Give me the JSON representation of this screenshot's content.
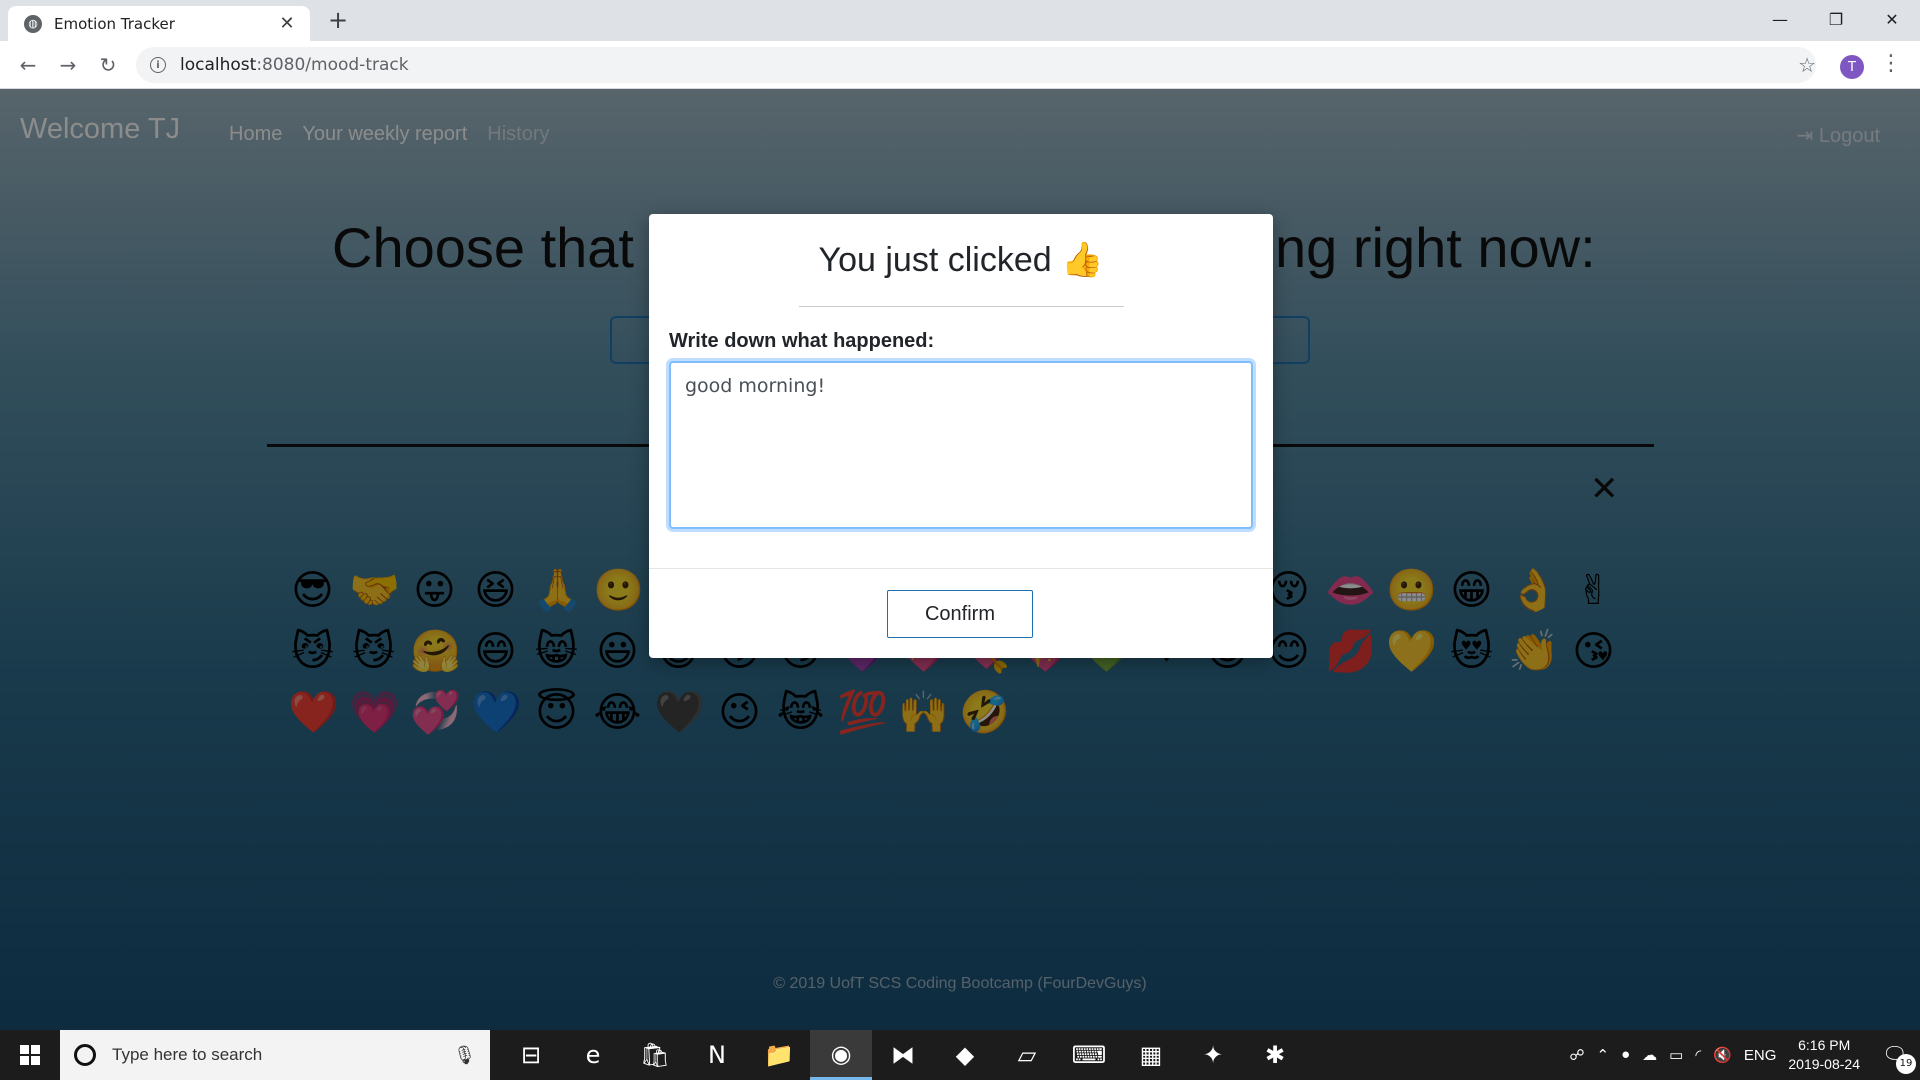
{
  "browser": {
    "tab_title": "Emotion Tracker",
    "tab_close": "✕",
    "new_tab": "+",
    "url_host": "localhost",
    "url_path": ":8080/mood-track",
    "profile_initial": "T",
    "window_controls": {
      "minimize": "—",
      "maximize": "❐",
      "close": "✕"
    },
    "nav": {
      "back": "←",
      "forward": "→",
      "reload": "↻"
    }
  },
  "navbar": {
    "brand": "Welcome TJ",
    "links": [
      "Home",
      "Your weekly report",
      "History"
    ],
    "logout": "Logout",
    "logout_icon": "⇥"
  },
  "main": {
    "headline_left": "Choose that",
    "headline_right": "ng right now:",
    "close_symbol": "✕",
    "emojis": [
      "😎",
      "🤝",
      "😛",
      "😆",
      "🙏",
      "🙂",
      "😚",
      "😊",
      "👍",
      "💋",
      "😅",
      "☺",
      "😌",
      "🤠",
      "😮",
      "🤞",
      "😚",
      "👄",
      "😬",
      "😁",
      "👌",
      "✌",
      "😼",
      "😼",
      "🤗",
      "😄",
      "😸",
      "😃",
      "😺",
      "😗",
      "😏",
      "💜",
      "💝",
      "💘",
      "💖",
      "💚",
      "❤",
      "😍",
      "😊",
      "💋",
      "💛",
      "😻",
      "👏",
      "😘",
      "❤️",
      "💗",
      "💞",
      "💙",
      "😇",
      "😂",
      "🖤",
      "😉",
      "😹",
      "💯",
      "🙌",
      "🤣"
    ],
    "footer": "© 2019 UofT SCS Coding Bootcamp (FourDevGuys)"
  },
  "modal": {
    "title": "You just clicked 👍",
    "label": "Write down what happened:",
    "textarea_value": "good morning!",
    "confirm_label": "Confirm"
  },
  "taskbar": {
    "search_placeholder": "Type here to search",
    "apps": [
      "⊟",
      "e",
      "🛍",
      "N",
      "📁",
      "◉",
      "⧓",
      "◆",
      "▱",
      "⌨",
      "▦",
      "✦",
      "✱"
    ],
    "tray_icons": [
      "☍",
      "⌃",
      "●",
      "☁",
      "▭",
      "◜",
      "🔇"
    ],
    "language": "ENG",
    "time": "6:16 PM",
    "date": "2019-08-24",
    "notification_count": "19"
  },
  "colors": {
    "accent": "#1f73b7",
    "textarea_focus": "#80bdff",
    "profile": "#7e57c2"
  }
}
